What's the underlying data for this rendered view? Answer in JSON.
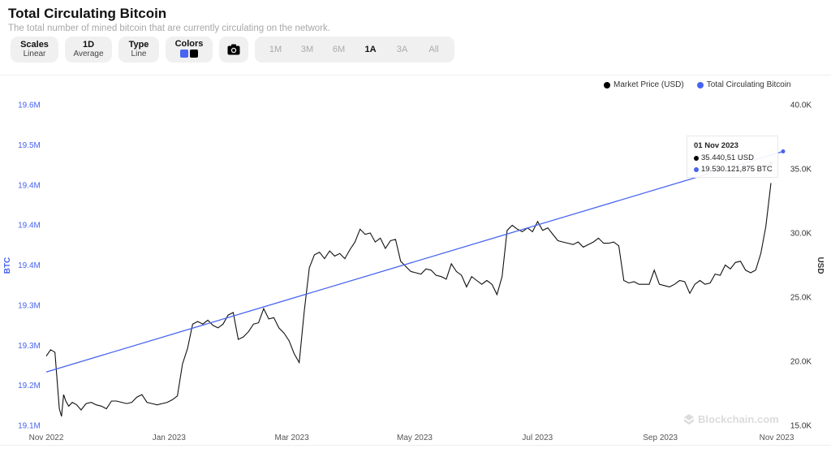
{
  "header": {
    "title": "Total Circulating Bitcoin",
    "subtitle": "The total number of mined bitcoin that are currently circulating on the network."
  },
  "toolbar": {
    "scales": {
      "label": "Scales",
      "value": "Linear"
    },
    "average": {
      "label": "1D",
      "value": "Average"
    },
    "type": {
      "label": "Type",
      "value": "Line"
    },
    "colors": {
      "label": "Colors",
      "swatches": [
        "#4763f0",
        "#000000"
      ]
    },
    "camera_icon": "camera-icon",
    "ranges": [
      "1M",
      "3M",
      "6M",
      "1A",
      "3A",
      "All"
    ],
    "active_range": "1A"
  },
  "legend": {
    "price": {
      "label": "Market Price (USD)",
      "color": "#000000"
    },
    "btc": {
      "label": "Total Circulating Bitcoin",
      "color": "#4763f0"
    }
  },
  "tooltip": {
    "date": "01 Nov 2023",
    "price": "35.440,51 USD",
    "btc": "19.530.121,875 BTC"
  },
  "watermark": "Blockchain.com",
  "chart_data": {
    "type": "line",
    "title": "Total Circulating Bitcoin",
    "x_tick_labels": [
      "Nov 2022",
      "Jan 2023",
      "Mar 2023",
      "May 2023",
      "Jul 2023",
      "Sep 2023",
      "Nov 2023"
    ],
    "x_range": [
      "2022-11-01",
      "2023-11-01"
    ],
    "left_axis": {
      "label": "BTC",
      "tick_labels": [
        "19.6M",
        "19.5M",
        "19.4M",
        "19.4M",
        "19.4M",
        "19.3M",
        "19.3M",
        "19.2M",
        "19.1M"
      ],
      "range": [
        19120000,
        19600000
      ],
      "color": "#4763f0"
    },
    "right_axis": {
      "label": "USD",
      "tick_labels": [
        "40.0K",
        "35.0K",
        "30.0K",
        "25.0K",
        "20.0K",
        "15.0K"
      ],
      "range": [
        15000,
        40000
      ]
    },
    "legend_position": "top-right",
    "grid": false,
    "series": [
      {
        "name": "Total Circulating Bitcoin",
        "axis": "left",
        "color": "#4763f0",
        "t": [
          0,
          1
        ],
        "values": [
          19200000,
          19530121.875
        ]
      },
      {
        "name": "Market Price (USD)",
        "axis": "right",
        "color": "#000000",
        "t": [
          0.0,
          0.006,
          0.012,
          0.018,
          0.021,
          0.024,
          0.027,
          0.031,
          0.036,
          0.042,
          0.048,
          0.055,
          0.062,
          0.069,
          0.076,
          0.083,
          0.09,
          0.097,
          0.104,
          0.111,
          0.118,
          0.125,
          0.132,
          0.139,
          0.146,
          0.153,
          0.16,
          0.167,
          0.174,
          0.181,
          0.188,
          0.195,
          0.202,
          0.209,
          0.216,
          0.223,
          0.23,
          0.237,
          0.244,
          0.251,
          0.258,
          0.265,
          0.272,
          0.279,
          0.286,
          0.293,
          0.3,
          0.307,
          0.314,
          0.321,
          0.328,
          0.335,
          0.342,
          0.349,
          0.356,
          0.363,
          0.37,
          0.377,
          0.384,
          0.391,
          0.398,
          0.405,
          0.412,
          0.419,
          0.426,
          0.433,
          0.44,
          0.447,
          0.454,
          0.461,
          0.468,
          0.475,
          0.482,
          0.489,
          0.496,
          0.503,
          0.51,
          0.517,
          0.524,
          0.531,
          0.538,
          0.545,
          0.552,
          0.559,
          0.566,
          0.573,
          0.58,
          0.587,
          0.594,
          0.601,
          0.608,
          0.615,
          0.622,
          0.629,
          0.636,
          0.643,
          0.65,
          0.657,
          0.664,
          0.671,
          0.678,
          0.685,
          0.692,
          0.699,
          0.706,
          0.713,
          0.72,
          0.727,
          0.734,
          0.741,
          0.748,
          0.755,
          0.762,
          0.769,
          0.776,
          0.783,
          0.79,
          0.797,
          0.804,
          0.811,
          0.818,
          0.825,
          0.832,
          0.839,
          0.846,
          0.853,
          0.86,
          0.867,
          0.874,
          0.881,
          0.888,
          0.895,
          0.902,
          0.909,
          0.916,
          0.923,
          0.93,
          0.937,
          0.944,
          0.951,
          0.958,
          0.965,
          0.972,
          0.979,
          0.986,
          0.993,
          1.0
        ],
        "values": [
          20400,
          20900,
          20700,
          16300,
          15700,
          17400,
          16900,
          16500,
          16800,
          16600,
          16200,
          16700,
          16800,
          16600,
          16500,
          16300,
          16900,
          16900,
          16800,
          16700,
          16800,
          17200,
          17400,
          16800,
          16700,
          16600,
          16700,
          16800,
          17000,
          17300,
          19800,
          21000,
          22900,
          23100,
          22900,
          23200,
          22800,
          22600,
          22900,
          23600,
          23800,
          21700,
          21900,
          22300,
          22900,
          23000,
          24100,
          23300,
          23400,
          22600,
          22200,
          21600,
          20600,
          19900,
          23900,
          27300,
          28300,
          28500,
          28000,
          28600,
          28200,
          28400,
          28000,
          28700,
          29300,
          30300,
          29900,
          30000,
          29300,
          29600,
          28800,
          29400,
          29500,
          27800,
          27400,
          27000,
          26900,
          26800,
          27200,
          27100,
          26700,
          26600,
          26400,
          27600,
          27000,
          26700,
          25800,
          26600,
          26300,
          26000,
          26300,
          26000,
          25200,
          26600,
          30200,
          30600,
          30300,
          30100,
          30400,
          30100,
          30900,
          30200,
          30400,
          29900,
          29400,
          29300,
          29200,
          29100,
          29300,
          28900,
          29100,
          29300,
          29600,
          29200,
          29200,
          29300,
          29000,
          26300,
          26100,
          26200,
          26000,
          26000,
          26000,
          27100,
          26000,
          25900,
          25800,
          26000,
          26300,
          26200,
          25300,
          26000,
          26300,
          26000,
          26100,
          26800,
          26700,
          27500,
          27200,
          27700,
          27800,
          27100,
          26900,
          27100,
          28400,
          30500,
          33900,
          34500,
          34300,
          34600,
          35440.51
        ]
      }
    ]
  }
}
